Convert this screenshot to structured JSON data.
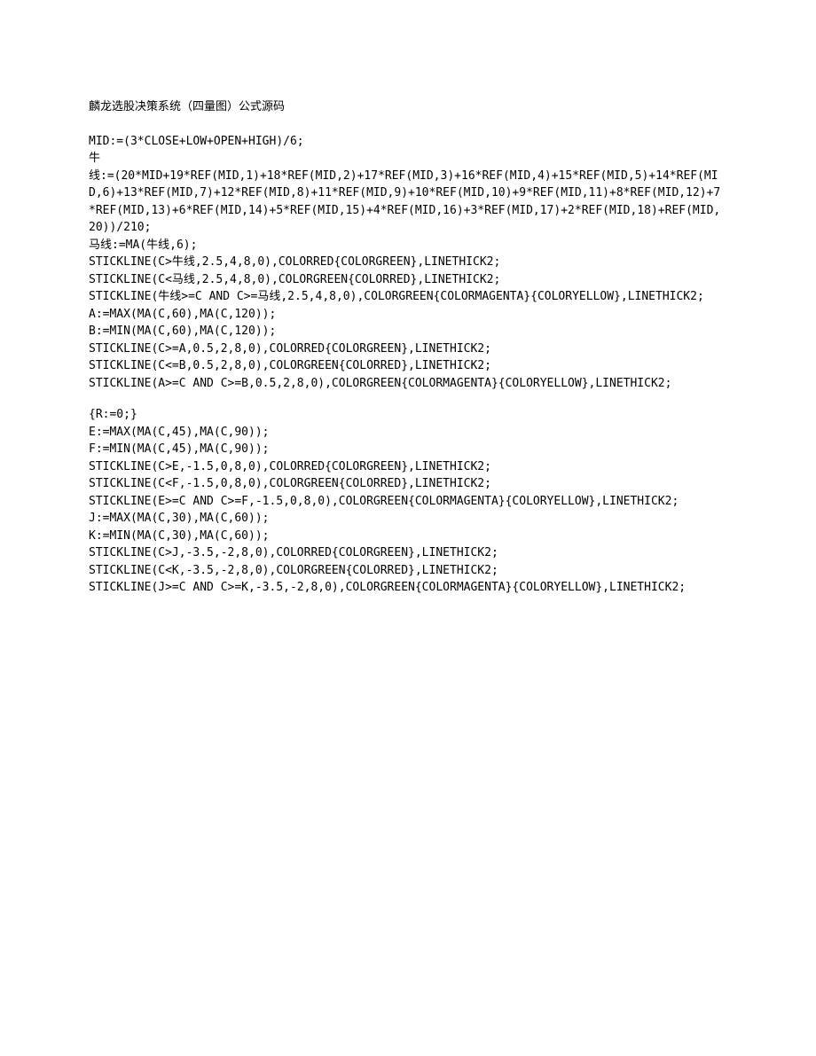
{
  "title": "麟龙选股决策系统（四量图）公式源码",
  "block1": "MID:=(3*CLOSE+LOW+OPEN+HIGH)/6;\n牛\n线:=(20*MID+19*REF(MID,1)+18*REF(MID,2)+17*REF(MID,3)+16*REF(MID,4)+15*REF(MID,5)+14*REF(MID,6)+13*REF(MID,7)+12*REF(MID,8)+11*REF(MID,9)+10*REF(MID,10)+9*REF(MID,11)+8*REF(MID,12)+7*REF(MID,13)+6*REF(MID,14)+5*REF(MID,15)+4*REF(MID,16)+3*REF(MID,17)+2*REF(MID,18)+REF(MID,20))/210;\n马线:=MA(牛线,6);\nSTICKLINE(C>牛线,2.5,4,8,0),COLORRED{COLORGREEN},LINETHICK2;\nSTICKLINE(C<马线,2.5,4,8,0),COLORGREEN{COLORRED},LINETHICK2;\nSTICKLINE(牛线>=C AND C>=马线,2.5,4,8,0),COLORGREEN{COLORMAGENTA}{COLORYELLOW},LINETHICK2;\nA:=MAX(MA(C,60),MA(C,120));\nB:=MIN(MA(C,60),MA(C,120));\nSTICKLINE(C>=A,0.5,2,8,0),COLORRED{COLORGREEN},LINETHICK2;\nSTICKLINE(C<=B,0.5,2,8,0),COLORGREEN{COLORRED},LINETHICK2;\nSTICKLINE(A>=C AND C>=B,0.5,2,8,0),COLORGREEN{COLORMAGENTA}{COLORYELLOW},LINETHICK2;",
  "block2": "{R:=0;}\nE:=MAX(MA(C,45),MA(C,90));\nF:=MIN(MA(C,45),MA(C,90));\nSTICKLINE(C>E,-1.5,0,8,0),COLORRED{COLORGREEN},LINETHICK2;\nSTICKLINE(C<F,-1.5,0,8,0),COLORGREEN{COLORRED},LINETHICK2;\nSTICKLINE(E>=C AND C>=F,-1.5,0,8,0),COLORGREEN{COLORMAGENTA}{COLORYELLOW},LINETHICK2;\nJ:=MAX(MA(C,30),MA(C,60));\nK:=MIN(MA(C,30),MA(C,60));\nSTICKLINE(C>J,-3.5,-2,8,0),COLORRED{COLORGREEN},LINETHICK2;\nSTICKLINE(C<K,-3.5,-2,8,0),COLORGREEN{COLORRED},LINETHICK2;\nSTICKLINE(J>=C AND C>=K,-3.5,-2,8,0),COLORGREEN{COLORMAGENTA}{COLORYELLOW},LINETHICK2;"
}
